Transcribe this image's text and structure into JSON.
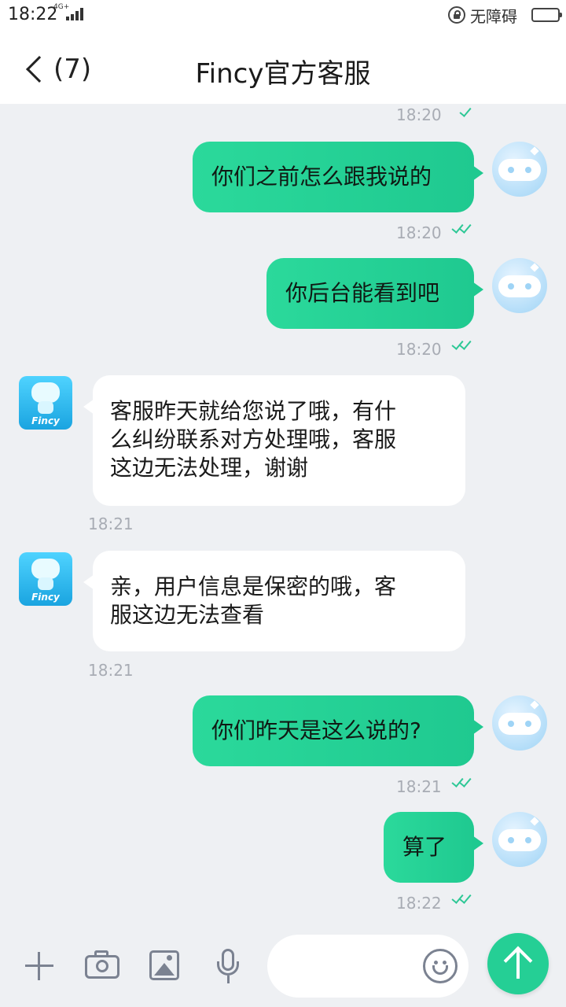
{
  "status_bar": {
    "time": "18:22",
    "network": "4G+",
    "accessibility": "无障碍"
  },
  "header": {
    "back_count": "(7)",
    "title": "Fincy官方客服"
  },
  "messages": [
    {
      "direction": "out",
      "text": "",
      "time": "18:20",
      "read": true
    },
    {
      "direction": "out",
      "text": "你们之前怎么跟我说的",
      "time": "18:20",
      "read": true
    },
    {
      "direction": "out",
      "text": "你后台能看到吧",
      "time": "18:20",
      "read": true
    },
    {
      "direction": "in",
      "text": "客服昨天就给您说了哦，有什么纠纷联系对方处理哦，客服这边无法处理，谢谢",
      "line1": "客服昨天就给您说了哦，有什",
      "line2": "么纠纷联系对方处理哦，客服",
      "line3": "这边无法处理，谢谢",
      "time": "18:21"
    },
    {
      "direction": "in",
      "text": "亲，用户信息是保密的哦，客服这边无法查看",
      "line1": "亲，用户信息是保密的哦，客",
      "line2": "服这边无法查看",
      "time": "18:21"
    },
    {
      "direction": "out",
      "text": "你们昨天是这么说的?",
      "time": "18:21",
      "read": true
    },
    {
      "direction": "out",
      "text": "算了",
      "time": "18:22",
      "read": true
    }
  ],
  "bot_avatar_brand": "Fincy",
  "input": {
    "placeholder": "",
    "icons": [
      "plus-icon",
      "camera-icon",
      "image-icon",
      "microphone-icon",
      "emoji-icon",
      "send-arrow-icon"
    ]
  },
  "colors": {
    "accent": "#25cf95",
    "outgoing_bubble": "#22d194",
    "incoming_bubble": "#ffffff",
    "background": "#eef0f3",
    "timestamp": "#a8acb4"
  }
}
